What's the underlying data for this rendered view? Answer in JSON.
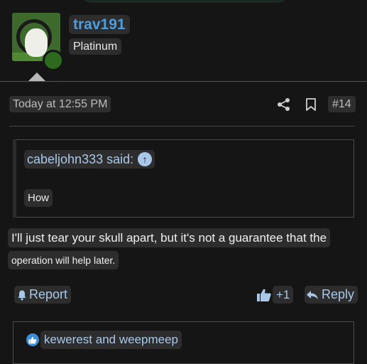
{
  "author": {
    "username": "trav191",
    "rank": "Platinum",
    "avatar": "dog-avatar",
    "online_color": "#2d6a1d"
  },
  "post": {
    "timestamp": "Today at 12:55 PM",
    "number": "#14",
    "actions": {
      "share_icon": "share-icon",
      "bookmark_icon": "bookmark-icon"
    }
  },
  "quote": {
    "author": "cabeljohn333 said:",
    "jump_icon": "arrow-up-circle-icon",
    "text": "How"
  },
  "body": {
    "line1": "I'll just tear your skull apart, but it's not a guarantee that the",
    "line2": "operation will help later."
  },
  "footer": {
    "report_label": "Report",
    "like_count": "+1",
    "reply_label": "Reply"
  },
  "reactions": {
    "text": "kewerest and weepmeep"
  },
  "colors": {
    "background": "#151515",
    "username": "#4a9fe0",
    "link": "#a8c8ea",
    "text_highlight": "#2d2d2d"
  }
}
